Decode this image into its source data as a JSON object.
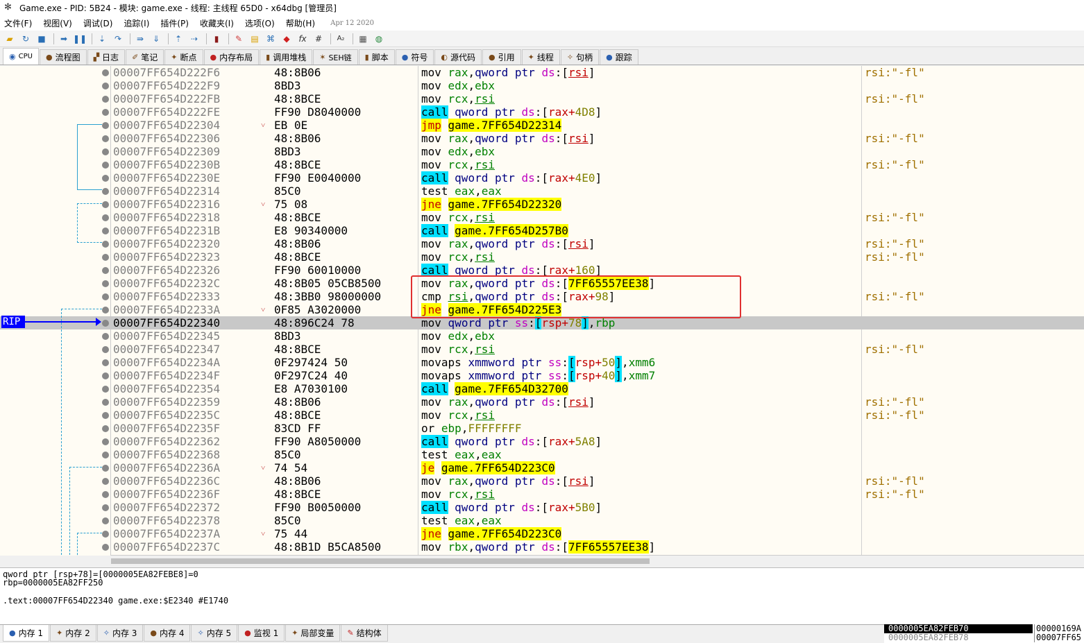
{
  "window": {
    "title": "Game.exe - PID: 5B24 - 模块: game.exe - 线程: 主线程 65D0 - x64dbg [管理员]"
  },
  "menu": {
    "items": [
      "文件(F)",
      "视图(V)",
      "调试(D)",
      "追踪(I)",
      "插件(P)",
      "收藏夹(I)",
      "选项(O)",
      "帮助(H)"
    ],
    "date": "Apr 12 2020"
  },
  "toolbar": {
    "icons": [
      "open-icon",
      "restart-icon",
      "stop-icon",
      "run-icon",
      "pause-icon",
      "step-into-icon",
      "step-over-icon",
      "trace-into-icon",
      "trace-over-icon",
      "execute-till-return-icon",
      "run-to-user-code-icon",
      "scylla-icon",
      "patch-icon",
      "comment-icon",
      "label-icon",
      "bookmark-icon",
      "function-icon",
      "hash-icon",
      "font-icon",
      "settings-icon",
      "globe-icon"
    ],
    "labels": {
      "fx": "fx",
      "hash": "#",
      "font": "A₂"
    }
  },
  "tabs": [
    {
      "label": "CPU",
      "icon": "cpu-icon"
    },
    {
      "label": "流程图",
      "icon": "graph-icon"
    },
    {
      "label": "日志",
      "icon": "log-icon"
    },
    {
      "label": "笔记",
      "icon": "notes-icon"
    },
    {
      "label": "断点",
      "icon": "breakpoint-icon"
    },
    {
      "label": "内存布局",
      "icon": "memory-map-icon"
    },
    {
      "label": "调用堆栈",
      "icon": "call-stack-icon"
    },
    {
      "label": "SEH链",
      "icon": "seh-icon"
    },
    {
      "label": "脚本",
      "icon": "script-icon"
    },
    {
      "label": "符号",
      "icon": "symbols-icon"
    },
    {
      "label": "源代码",
      "icon": "source-icon"
    },
    {
      "label": "引用",
      "icon": "references-icon"
    },
    {
      "label": "线程",
      "icon": "threads-icon"
    },
    {
      "label": "句柄",
      "icon": "handles-icon"
    },
    {
      "label": "跟踪",
      "icon": "trace-icon"
    }
  ],
  "disasm": {
    "rip_label": "RIP",
    "lines": [
      {
        "addr": "00007FF654D222F6",
        "bytes": "48:8B06",
        "arrow": "",
        "cmt": "rsi:\"-fl\""
      },
      {
        "addr": "00007FF654D222F9",
        "bytes": "8BD3",
        "arrow": "",
        "cmt": ""
      },
      {
        "addr": "00007FF654D222FB",
        "bytes": "48:8BCE",
        "arrow": "",
        "cmt": "rsi:\"-fl\""
      },
      {
        "addr": "00007FF654D222FE",
        "bytes": "FF90 D8040000",
        "arrow": "",
        "cmt": ""
      },
      {
        "addr": "00007FF654D22304",
        "bytes": "EB 0E",
        "arrow": "˅",
        "cmt": ""
      },
      {
        "addr": "00007FF654D22306",
        "bytes": "48:8B06",
        "arrow": "",
        "cmt": "rsi:\"-fl\""
      },
      {
        "addr": "00007FF654D22309",
        "bytes": "8BD3",
        "arrow": "",
        "cmt": ""
      },
      {
        "addr": "00007FF654D2230B",
        "bytes": "48:8BCE",
        "arrow": "",
        "cmt": "rsi:\"-fl\""
      },
      {
        "addr": "00007FF654D2230E",
        "bytes": "FF90 E0040000",
        "arrow": "",
        "cmt": ""
      },
      {
        "addr": "00007FF654D22314",
        "bytes": "85C0",
        "arrow": "",
        "cmt": ""
      },
      {
        "addr": "00007FF654D22316",
        "bytes": "75 08",
        "arrow": "˅",
        "cmt": ""
      },
      {
        "addr": "00007FF654D22318",
        "bytes": "48:8BCE",
        "arrow": "",
        "cmt": "rsi:\"-fl\""
      },
      {
        "addr": "00007FF654D2231B",
        "bytes": "E8 90340000",
        "arrow": "",
        "cmt": ""
      },
      {
        "addr": "00007FF654D22320",
        "bytes": "48:8B06",
        "arrow": "",
        "cmt": "rsi:\"-fl\""
      },
      {
        "addr": "00007FF654D22323",
        "bytes": "48:8BCE",
        "arrow": "",
        "cmt": "rsi:\"-fl\""
      },
      {
        "addr": "00007FF654D22326",
        "bytes": "FF90 60010000",
        "arrow": "",
        "cmt": ""
      },
      {
        "addr": "00007FF654D2232C",
        "bytes": "48:8B05 05CB8500",
        "arrow": "",
        "cmt": ""
      },
      {
        "addr": "00007FF654D22333",
        "bytes": "48:3BB0 98000000",
        "arrow": "",
        "cmt": "rsi:\"-fl\""
      },
      {
        "addr": "00007FF654D2233A",
        "bytes": "0F85 A3020000",
        "arrow": "˅",
        "cmt": ""
      },
      {
        "addr": "00007FF654D22340",
        "bytes": "48:896C24 78",
        "arrow": "",
        "cmt": ""
      },
      {
        "addr": "00007FF654D22345",
        "bytes": "8BD3",
        "arrow": "",
        "cmt": ""
      },
      {
        "addr": "00007FF654D22347",
        "bytes": "48:8BCE",
        "arrow": "",
        "cmt": "rsi:\"-fl\""
      },
      {
        "addr": "00007FF654D2234A",
        "bytes": "0F297424 50",
        "arrow": "",
        "cmt": ""
      },
      {
        "addr": "00007FF654D2234F",
        "bytes": "0F297C24 40",
        "arrow": "",
        "cmt": ""
      },
      {
        "addr": "00007FF654D22354",
        "bytes": "E8 A7030100",
        "arrow": "",
        "cmt": ""
      },
      {
        "addr": "00007FF654D22359",
        "bytes": "48:8B06",
        "arrow": "",
        "cmt": "rsi:\"-fl\""
      },
      {
        "addr": "00007FF654D2235C",
        "bytes": "48:8BCE",
        "arrow": "",
        "cmt": "rsi:\"-fl\""
      },
      {
        "addr": "00007FF654D2235F",
        "bytes": "83CD FF",
        "arrow": "",
        "cmt": ""
      },
      {
        "addr": "00007FF654D22362",
        "bytes": "FF90 A8050000",
        "arrow": "",
        "cmt": ""
      },
      {
        "addr": "00007FF654D22368",
        "bytes": "85C0",
        "arrow": "",
        "cmt": ""
      },
      {
        "addr": "00007FF654D2236A",
        "bytes": "74 54",
        "arrow": "˅",
        "cmt": ""
      },
      {
        "addr": "00007FF654D2236C",
        "bytes": "48:8B06",
        "arrow": "",
        "cmt": "rsi:\"-fl\""
      },
      {
        "addr": "00007FF654D2236F",
        "bytes": "48:8BCE",
        "arrow": "",
        "cmt": "rsi:\"-fl\""
      },
      {
        "addr": "00007FF654D22372",
        "bytes": "FF90 B0050000",
        "arrow": "",
        "cmt": ""
      },
      {
        "addr": "00007FF654D22378",
        "bytes": "85C0",
        "arrow": "",
        "cmt": ""
      },
      {
        "addr": "00007FF654D2237A",
        "bytes": "75 44",
        "arrow": "˅",
        "cmt": ""
      },
      {
        "addr": "00007FF654D2237C",
        "bytes": "48:8B1D B5CA8500",
        "arrow": "",
        "cmt": ""
      }
    ],
    "instr": {
      "i0": {
        "m": "mov",
        "a": "rax",
        "b": "qword ptr",
        "s": "ds",
        "r": "rsi"
      },
      "i1": {
        "m": "mov",
        "a": "edx",
        "b": "ebx"
      },
      "i2": {
        "m": "mov",
        "a": "rcx",
        "b": "rsi"
      },
      "i3": {
        "m": "call",
        "b": "qword ptr",
        "s": "ds",
        "r": "rax+4D8"
      },
      "i4": {
        "m": "jmp",
        "t": "game.7FF654D22314"
      },
      "i5": {
        "m": "mov",
        "a": "rax",
        "b": "qword ptr",
        "s": "ds",
        "r": "rsi"
      },
      "i6": {
        "m": "mov",
        "a": "edx",
        "b": "ebx"
      },
      "i7": {
        "m": "mov",
        "a": "rcx",
        "b": "rsi"
      },
      "i8": {
        "m": "call",
        "b": "qword ptr",
        "s": "ds",
        "r": "rax+4E0"
      },
      "i9": {
        "m": "test",
        "a": "eax",
        "b": "eax"
      },
      "i10": {
        "m": "jne",
        "t": "game.7FF654D22320"
      },
      "i11": {
        "m": "mov",
        "a": "rcx",
        "b": "rsi"
      },
      "i12": {
        "m": "call",
        "t": "game.7FF654D257B0"
      },
      "i13": {
        "m": "mov",
        "a": "rax",
        "b": "qword ptr",
        "s": "ds",
        "r": "rsi"
      },
      "i14": {
        "m": "mov",
        "a": "rcx",
        "b": "rsi"
      },
      "i15": {
        "m": "call",
        "b": "qword ptr",
        "s": "ds",
        "r": "rax+160"
      },
      "i16": {
        "m": "mov",
        "a": "rax",
        "b": "qword ptr",
        "s": "ds",
        "r": "7FF65557EE38"
      },
      "i17": {
        "m": "cmp",
        "a": "rsi",
        "b": "qword ptr",
        "s": "ds",
        "r": "rax+98"
      },
      "i18": {
        "m": "jne",
        "t": "game.7FF654D225E3"
      },
      "i19": {
        "m": "mov",
        "b": "qword ptr",
        "s": "ss",
        "r": "rsp+78",
        "c": "rbp"
      },
      "i20": {
        "m": "mov",
        "a": "edx",
        "b": "ebx"
      },
      "i21": {
        "m": "mov",
        "a": "rcx",
        "b": "rsi"
      },
      "i22": {
        "m": "movaps",
        "b": "xmmword ptr",
        "s": "ss",
        "r": "rsp+50",
        "c": "xmm6"
      },
      "i23": {
        "m": "movaps",
        "b": "xmmword ptr",
        "s": "ss",
        "r": "rsp+40",
        "c": "xmm7"
      },
      "i24": {
        "m": "call",
        "t": "game.7FF654D32700"
      },
      "i25": {
        "m": "mov",
        "a": "rax",
        "b": "qword ptr",
        "s": "ds",
        "r": "rsi"
      },
      "i26": {
        "m": "mov",
        "a": "rcx",
        "b": "rsi"
      },
      "i27": {
        "m": "or",
        "a": "ebp",
        "b": "FFFFFFFF"
      },
      "i28": {
        "m": "call",
        "b": "qword ptr",
        "s": "ds",
        "r": "rax+5A8"
      },
      "i29": {
        "m": "test",
        "a": "eax",
        "b": "eax"
      },
      "i30": {
        "m": "je",
        "t": "game.7FF654D223C0"
      },
      "i31": {
        "m": "mov",
        "a": "rax",
        "b": "qword ptr",
        "s": "ds",
        "r": "rsi"
      },
      "i32": {
        "m": "mov",
        "a": "rcx",
        "b": "rsi"
      },
      "i33": {
        "m": "call",
        "b": "qword ptr",
        "s": "ds",
        "r": "rax+5B0"
      },
      "i34": {
        "m": "test",
        "a": "eax",
        "b": "eax"
      },
      "i35": {
        "m": "jne",
        "t": "game.7FF654D223C0"
      },
      "i36": {
        "m": "mov",
        "a": "rbx",
        "b": "qword ptr",
        "s": "ds",
        "r": "7FF65557EE38"
      }
    }
  },
  "info": {
    "line1": "qword ptr [rsp+78]=[0000005EA82FEBE8]=0",
    "line2": "rbp=0000005EA82FF250",
    "line3": ".text:00007FF654D22340 game.exe:$E2340 #E1740"
  },
  "bottom_tabs": [
    {
      "label": "内存 1",
      "icon": "memory-icon"
    },
    {
      "label": "内存 2",
      "icon": "memory-icon"
    },
    {
      "label": "内存 3",
      "icon": "memory-icon"
    },
    {
      "label": "内存 4",
      "icon": "memory-icon"
    },
    {
      "label": "内存 5",
      "icon": "memory-icon"
    },
    {
      "label": "监视 1",
      "icon": "watch-icon"
    },
    {
      "label": "局部变量",
      "icon": "locals-icon"
    },
    {
      "label": "结构体",
      "icon": "struct-icon"
    }
  ],
  "stack": {
    "row1": "0000005EA82FEB70",
    "row2": "0000005EA82FEB78",
    "col2_row1": "00000169A",
    "col2_row2": "00007FF65"
  }
}
